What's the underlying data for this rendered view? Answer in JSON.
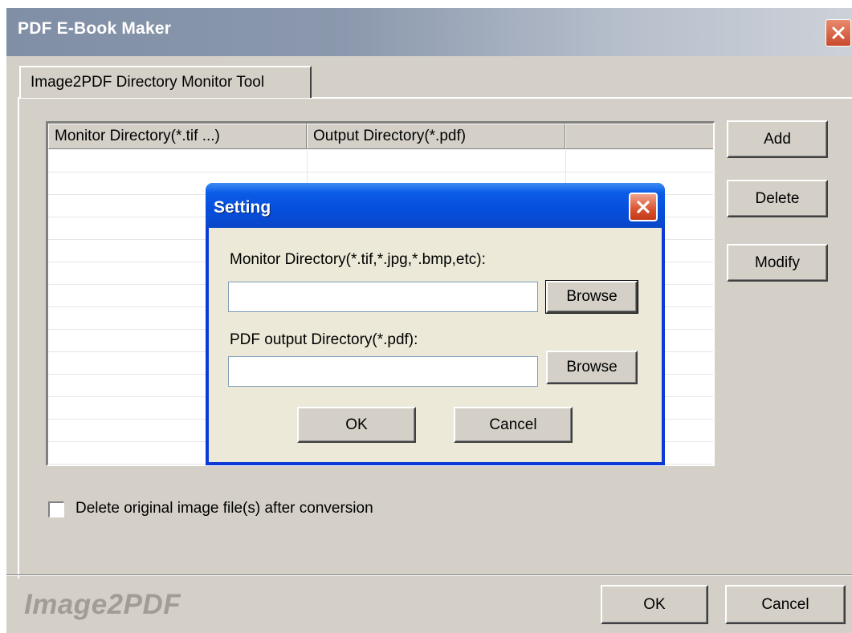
{
  "window": {
    "title": "PDF E-Book Maker"
  },
  "tab": {
    "label": "Image2PDF Directory Monitor Tool"
  },
  "table": {
    "columns": [
      "Monitor Directory(*.tif ...)",
      "Output Directory(*.pdf)",
      ""
    ],
    "rows": []
  },
  "side_buttons": {
    "add": "Add",
    "delete": "Delete",
    "modify": "Modify"
  },
  "options": {
    "delete_original_label": "Delete original image file(s) after conversion",
    "delete_original_checked": false
  },
  "footer": {
    "brand": "Image2PDF",
    "ok": "OK",
    "cancel": "Cancel"
  },
  "dialog": {
    "title": "Setting",
    "monitor_label": "Monitor Directory(*.tif,*.jpg,*.bmp,etc):",
    "monitor_value": "",
    "browse_monitor": "Browse",
    "output_label": "PDF output Directory(*.pdf):",
    "output_value": "",
    "browse_output": "Browse",
    "ok": "OK",
    "cancel": "Cancel"
  },
  "colors": {
    "window_bg": "#d4d0c8",
    "dialog_title": "#0650df",
    "dialog_body": "#ece9d8",
    "close_red": "#d9522f"
  },
  "icons": {
    "window_close": "close-icon",
    "dialog_close": "close-icon",
    "checkbox": "checkbox-empty"
  }
}
